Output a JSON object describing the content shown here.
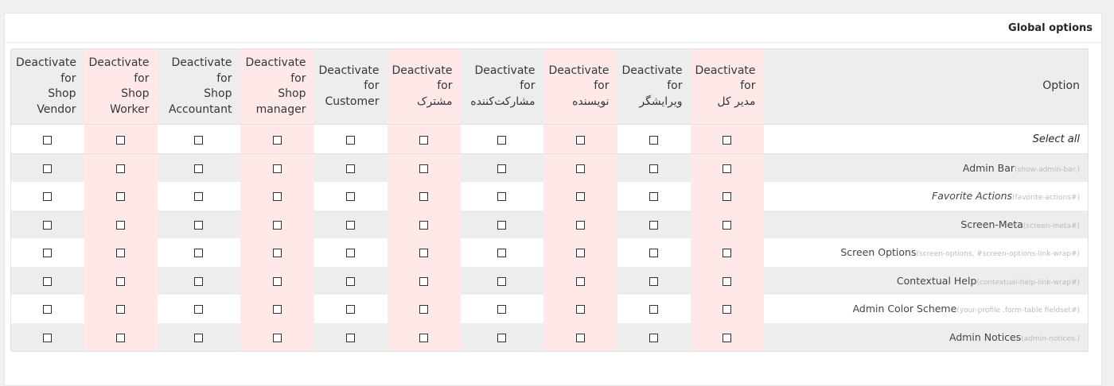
{
  "panel": {
    "title": "Global options"
  },
  "table": {
    "option_header": "Option",
    "columns": [
      [
        "Deactivate",
        "for",
        "Shop",
        "Vendor"
      ],
      [
        "Deactivate",
        "for",
        "Shop",
        "Worker"
      ],
      [
        "Deactivate",
        "for",
        "Shop",
        "Accountant"
      ],
      [
        "Deactivate",
        "for",
        "Shop",
        "manager"
      ],
      [
        "Deactivate",
        "for",
        "Customer"
      ],
      [
        "Deactivate",
        "for",
        "مشترک"
      ],
      [
        "Deactivate",
        "for",
        "مشارکت‌کننده"
      ],
      [
        "Deactivate",
        "for",
        "نویسنده"
      ],
      [
        "Deactivate",
        "for",
        "ویرایشگر"
      ],
      [
        "Deactivate",
        "for",
        "مدیر کل"
      ]
    ],
    "pink_columns": [
      1,
      3,
      5,
      7,
      9
    ],
    "select_all_label": "Select all",
    "rows": [
      {
        "name": "Admin Bar",
        "selector": "(show-admin-bar.)",
        "italic": false
      },
      {
        "name": "Favorite Actions",
        "selector": "(favorite-actions#)",
        "italic": true
      },
      {
        "name": "Screen-Meta",
        "selector": "(screen-meta#)",
        "italic": false
      },
      {
        "name": "Screen Options",
        "selector": "(screen-options, #screen-options-link-wrap#)",
        "italic": false
      },
      {
        "name": "Contextual Help",
        "selector": "(contextual-help-link-wrap#)",
        "italic": false
      },
      {
        "name": "Admin Color Scheme",
        "selector": "(your-profile .form-table fieldset#)",
        "italic": false
      },
      {
        "name": "Admin Notices",
        "selector": "(admin-notices.)",
        "italic": false
      }
    ]
  }
}
